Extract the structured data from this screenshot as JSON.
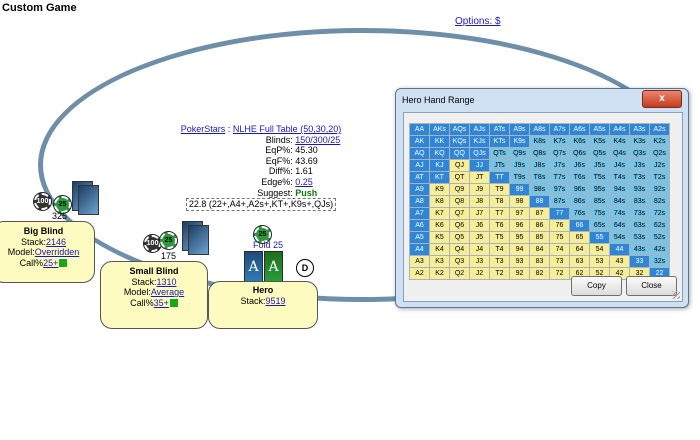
{
  "window": {
    "title": "Custom Game",
    "options_label": "Options: $"
  },
  "info": {
    "site": "PokerStars",
    "sep": ":",
    "table": "NLHE Full Table (50,30,20)",
    "rows": [
      {
        "label": "Blinds:",
        "value": "150/300/25",
        "link": true
      },
      {
        "label": "EqP%:",
        "value": "45.30"
      },
      {
        "label": "EqF%:",
        "value": "43.69"
      },
      {
        "label": "Diff%:",
        "value": "1.61"
      },
      {
        "label": "Edge%:",
        "value": "0.25",
        "link": true
      }
    ],
    "suggest_label": "Suggest:",
    "suggest_value": "Push",
    "suggest_range": "22.8 (22+,A4+,A2s+,KT+,K9s+,QJs)"
  },
  "players": {
    "big_blind": {
      "name": "Big Blind",
      "stack_label": "Stack:",
      "stack": "2146",
      "model_label": "Model:",
      "model": "Overridden",
      "call_label": "Call%",
      "call": "25+",
      "bet": "325",
      "chip_top": "100",
      "chip_main": "25"
    },
    "small_blind": {
      "name": "Small Blind",
      "stack_label": "Stack:",
      "stack": "1310",
      "model_label": "Model:",
      "model": "Average",
      "call_label": "Call%",
      "call": "35+",
      "bet": "175",
      "chip_top": "100",
      "chip_main": "25"
    },
    "hero": {
      "name": "Hero",
      "stack_label": "Stack:",
      "stack": "9519",
      "fold_label": "Fold",
      "fold_amount": "25",
      "chip_main": "25",
      "card1": "A",
      "card2": "A",
      "dealer": "D"
    }
  },
  "dialog": {
    "title": "Hero Hand Range",
    "close_x": "x",
    "copy_label": "Copy",
    "close_label": "Close",
    "legend": {
      "in_range_color": "#2f86d6",
      "marginal_color": "#78c4e6",
      "out_color": "#f7ee9a"
    },
    "grid": [
      [
        "AA",
        "AKs",
        "AQs",
        "AJs",
        "ATs",
        "A9s",
        "A8s",
        "A7s",
        "A6s",
        "A5s",
        "A4s",
        "A3s",
        "A2s"
      ],
      [
        "AK",
        "KK",
        "KQs",
        "KJs",
        "KTs",
        "K9s",
        "K8s",
        "K7s",
        "K6s",
        "K5s",
        "K4s",
        "K3s",
        "K2s"
      ],
      [
        "AQ",
        "KQ",
        "QQ",
        "QJs",
        "QTs",
        "Q9s",
        "Q8s",
        "Q7s",
        "Q6s",
        "Q5s",
        "Q4s",
        "Q3s",
        "Q2s"
      ],
      [
        "AJ",
        "KJ",
        "QJ",
        "JJ",
        "JTs",
        "J9s",
        "J8s",
        "J7s",
        "J6s",
        "J5s",
        "J4s",
        "J3s",
        "J2s"
      ],
      [
        "AT",
        "KT",
        "QT",
        "JT",
        "TT",
        "T9s",
        "T8s",
        "T7s",
        "T6s",
        "T5s",
        "T4s",
        "T3s",
        "T2s"
      ],
      [
        "A9",
        "K9",
        "Q9",
        "J9",
        "T9",
        "99",
        "98s",
        "97s",
        "96s",
        "95s",
        "94s",
        "93s",
        "92s"
      ],
      [
        "A8",
        "K8",
        "Q8",
        "J8",
        "T8",
        "98",
        "88",
        "87s",
        "86s",
        "85s",
        "84s",
        "83s",
        "82s"
      ],
      [
        "A7",
        "K7",
        "Q7",
        "J7",
        "T7",
        "97",
        "87",
        "77",
        "76s",
        "75s",
        "74s",
        "73s",
        "72s"
      ],
      [
        "A6",
        "K6",
        "Q6",
        "J6",
        "T6",
        "96",
        "86",
        "76",
        "66",
        "65s",
        "64s",
        "63s",
        "62s"
      ],
      [
        "A5",
        "K5",
        "Q5",
        "J5",
        "T5",
        "95",
        "85",
        "75",
        "65",
        "55",
        "54s",
        "53s",
        "52s"
      ],
      [
        "A4",
        "K4",
        "Q4",
        "J4",
        "T4",
        "94",
        "84",
        "74",
        "64",
        "54",
        "44",
        "43s",
        "42s"
      ],
      [
        "A3",
        "K3",
        "Q3",
        "J3",
        "T3",
        "93",
        "83",
        "73",
        "63",
        "53",
        "43",
        "33",
        "32s"
      ],
      [
        "A2",
        "K2",
        "Q2",
        "J2",
        "T2",
        "92",
        "82",
        "72",
        "62",
        "52",
        "42",
        "32",
        "22"
      ]
    ],
    "styles": [
      [
        1,
        1,
        1,
        1,
        1,
        1,
        1,
        1,
        1,
        1,
        1,
        1,
        1
      ],
      [
        1,
        1,
        1,
        1,
        1,
        1,
        2,
        2,
        2,
        2,
        2,
        2,
        2
      ],
      [
        1,
        1,
        1,
        1,
        2,
        2,
        2,
        2,
        2,
        2,
        2,
        2,
        2
      ],
      [
        1,
        1,
        0,
        1,
        2,
        2,
        2,
        2,
        2,
        2,
        2,
        2,
        2
      ],
      [
        1,
        1,
        0,
        0,
        1,
        2,
        2,
        2,
        2,
        2,
        2,
        2,
        2
      ],
      [
        1,
        0,
        0,
        0,
        0,
        1,
        2,
        2,
        2,
        2,
        2,
        2,
        2
      ],
      [
        1,
        0,
        0,
        0,
        0,
        0,
        1,
        2,
        2,
        2,
        2,
        2,
        2
      ],
      [
        1,
        0,
        0,
        0,
        0,
        0,
        0,
        1,
        2,
        2,
        2,
        2,
        2
      ],
      [
        1,
        0,
        0,
        0,
        0,
        0,
        0,
        0,
        1,
        2,
        2,
        2,
        2
      ],
      [
        1,
        0,
        0,
        0,
        0,
        0,
        0,
        0,
        0,
        1,
        2,
        2,
        2
      ],
      [
        1,
        0,
        0,
        0,
        0,
        0,
        0,
        0,
        0,
        0,
        1,
        2,
        2
      ],
      [
        0,
        0,
        0,
        0,
        0,
        0,
        0,
        0,
        0,
        0,
        0,
        1,
        2
      ],
      [
        0,
        0,
        0,
        0,
        0,
        0,
        0,
        0,
        0,
        0,
        0,
        0,
        1
      ]
    ]
  }
}
